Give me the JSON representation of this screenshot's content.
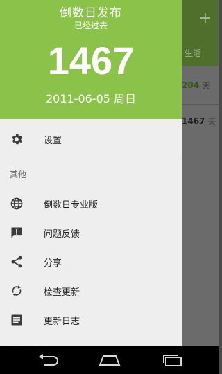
{
  "background": {
    "tab_label": "生活",
    "rows": [
      {
        "value": "204",
        "unit": "天"
      },
      {
        "value": "1467",
        "unit": "天"
      }
    ]
  },
  "drawer": {
    "header": {
      "title": "倒数日发布",
      "subtitle": "已经过去",
      "days": "1467",
      "date": "2011-06-05 周日"
    },
    "settings_label": "设置",
    "section_other": "其他",
    "items": [
      {
        "label": "倒数日专业版",
        "icon": "globe-icon"
      },
      {
        "label": "问题反馈",
        "icon": "feedback-icon"
      },
      {
        "label": "分享",
        "icon": "share-icon"
      },
      {
        "label": "检查更新",
        "icon": "refresh-icon"
      },
      {
        "label": "更新日志",
        "icon": "log-icon"
      }
    ]
  },
  "colors": {
    "accent": "#8bc34a",
    "drawer_bg": "#eeeeee",
    "icon": "#3c3c3c"
  }
}
